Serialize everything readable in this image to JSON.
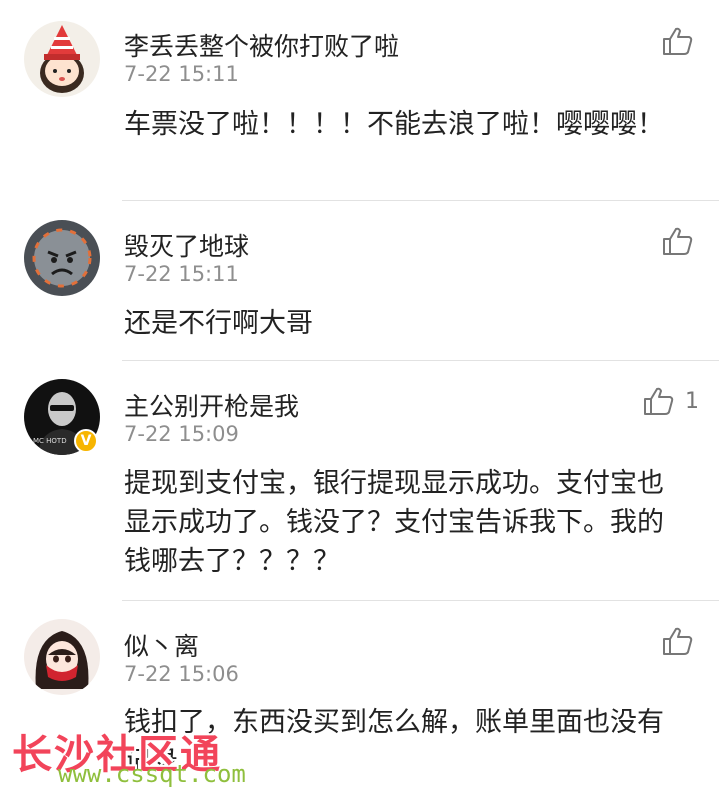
{
  "comments": [
    {
      "username": "李丢丢整个被你打败了啦",
      "time": "7-22 15:11",
      "text": "车票没了啦！！！！不能去浪了啦！嘤嘤嘤！",
      "like_count": "",
      "avatar": "cartoon-girl-red-hat"
    },
    {
      "username": "毁灭了地球",
      "time": "7-22 15:11",
      "text": "还是不行啊大哥",
      "like_count": "",
      "avatar": "angry-planet"
    },
    {
      "username": "主公别开枪是我",
      "time": "7-22 15:09",
      "text": "提现到支付宝，银行提现显示成功。支付宝也显示成功了。钱没了？支付宝告诉我下。我的钱哪去了？？？？",
      "like_count": "1",
      "avatar": "man-sunglasses-mc-hotdog",
      "avatar_text": "MC HOTD",
      "verified_mark": "V"
    },
    {
      "username": "似丶离",
      "time": "7-22 15:06",
      "text": "钱扣了，东西没买到怎么解，账单里面也没有记录",
      "like_count": "",
      "avatar": "anime-girl-red-mask"
    }
  ],
  "watermark": {
    "title": "长沙社区通",
    "url": "www.cssqt.com"
  },
  "colors": {
    "username": "#222222",
    "time": "#8e8e8e",
    "divider": "#e2e2e2",
    "verified": "#f7b500",
    "watermark": "#f2445a"
  }
}
